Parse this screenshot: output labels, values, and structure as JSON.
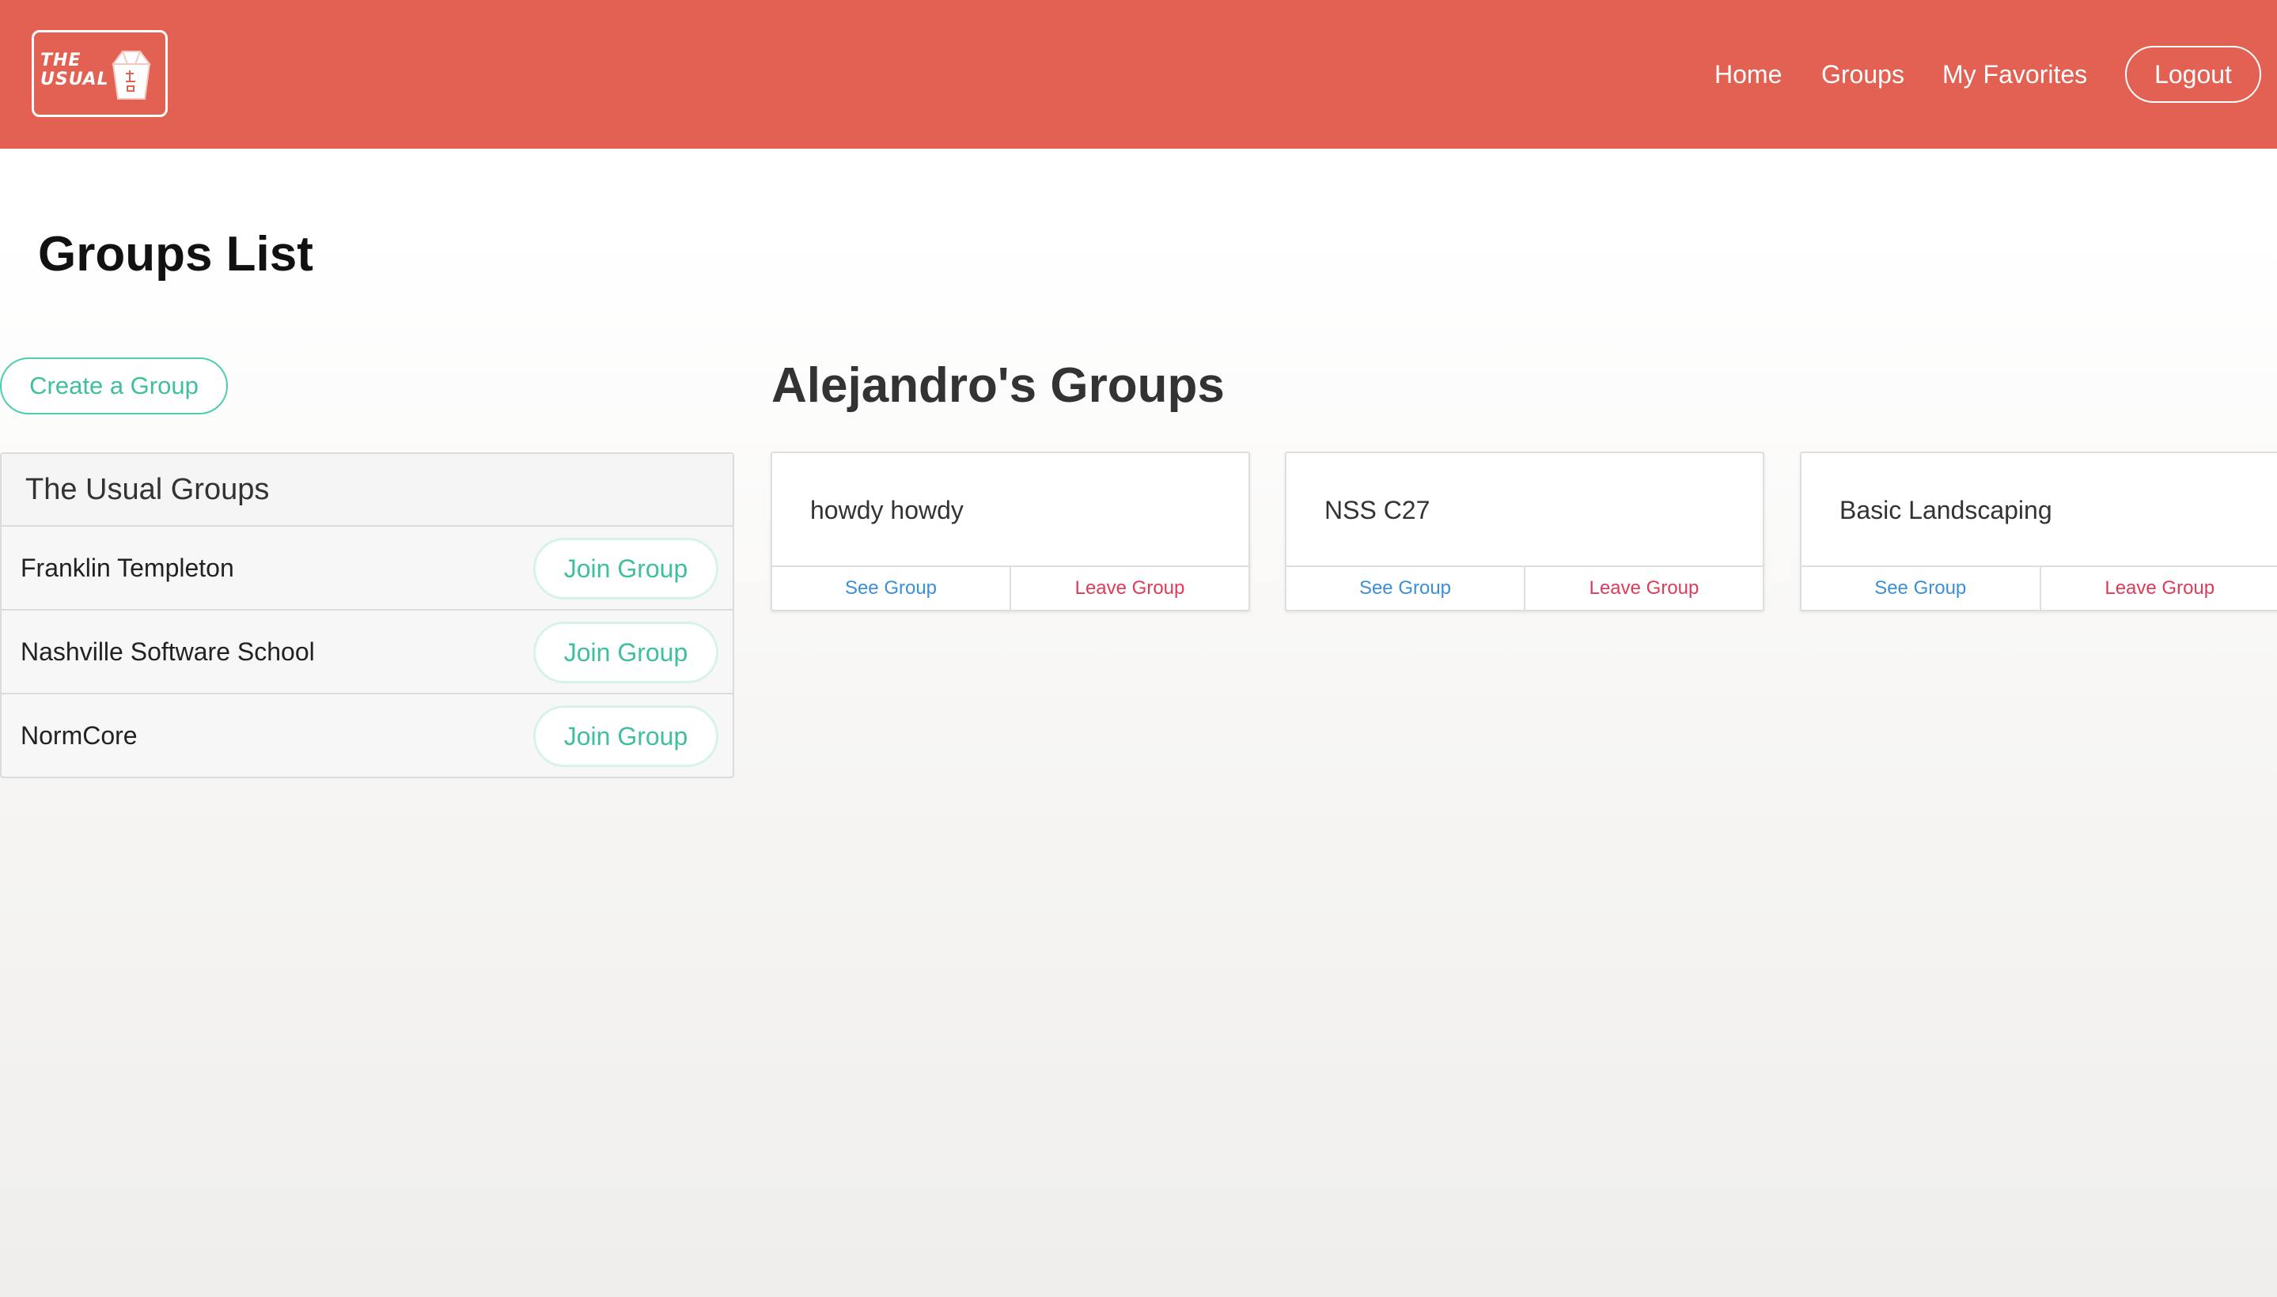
{
  "navbar": {
    "logo_text_line1": "THE",
    "logo_text_line2": "USUAL",
    "links": [
      "Home",
      "Groups",
      "My Favorites"
    ],
    "logout_label": "Logout"
  },
  "page": {
    "title": "Groups List"
  },
  "sidebar": {
    "create_label": "Create a Group",
    "panel_title": "The Usual Groups",
    "rows": [
      {
        "name": "Franklin Templeton",
        "action": "Join Group"
      },
      {
        "name": "Nashville Software School",
        "action": "Join Group"
      },
      {
        "name": "NormCore",
        "action": "Join Group"
      }
    ]
  },
  "my_groups": {
    "title": "Alejandro's Groups",
    "cards": [
      {
        "name": "howdy howdy",
        "see_label": "See Group",
        "leave_label": "Leave Group"
      },
      {
        "name": "NSS C27",
        "see_label": "See Group",
        "leave_label": "Leave Group"
      },
      {
        "name": "Basic Landscaping",
        "see_label": "See Group",
        "leave_label": "Leave Group"
      }
    ]
  },
  "colors": {
    "navbar": "#e36152",
    "accent": "#3fbf9f",
    "link_blue": "#3b8fd6",
    "danger": "#dc3c5a"
  },
  "icons": {
    "logo": "takeout-box-icon"
  }
}
